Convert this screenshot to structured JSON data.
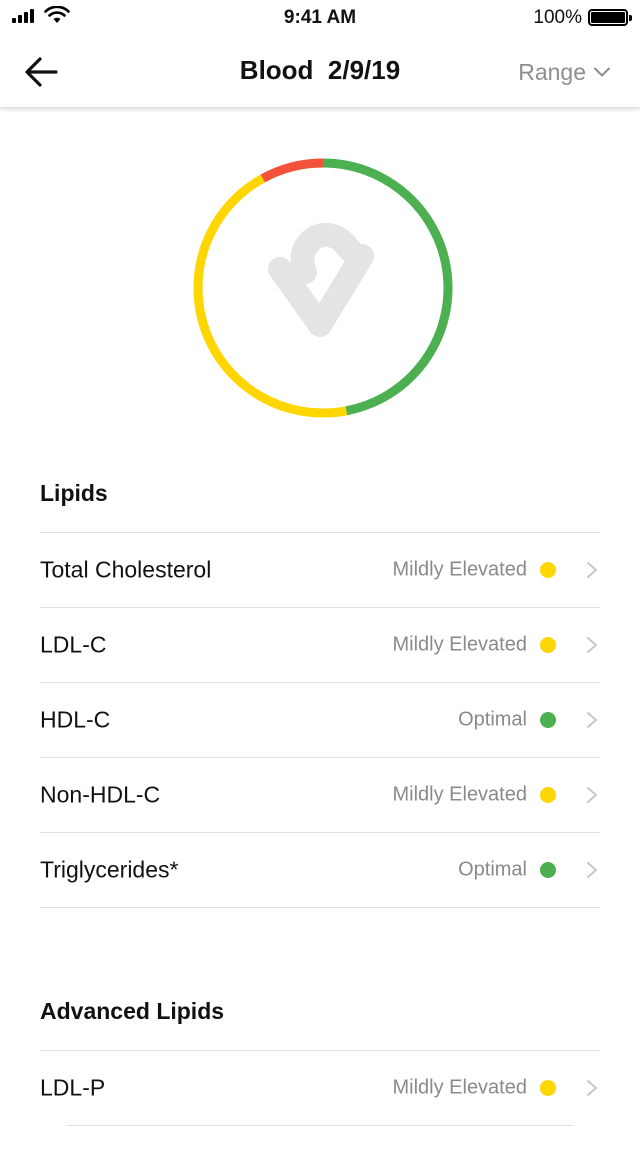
{
  "status_bar": {
    "time": "9:41 AM",
    "battery": "100%"
  },
  "header": {
    "title": "Blood  2/9/19",
    "range_label": "Range"
  },
  "colors": {
    "optimal": "#4caf50",
    "mildly_elevated": "#ffd600",
    "elevated": "#f4513b",
    "divider": "#e0e0e0"
  },
  "score_ring": {
    "icon": "heart-icon",
    "segments": [
      {
        "status": "elevated",
        "fraction": 0.08
      },
      {
        "status": "optimal",
        "fraction": 0.47
      },
      {
        "status": "mildly_elevated",
        "fraction": 0.45
      }
    ]
  },
  "sections": [
    {
      "title": "Lipids",
      "items": [
        {
          "name": "Total Cholesterol",
          "status": "Mildly Elevated",
          "level": "mildly_elevated"
        },
        {
          "name": "LDL-C",
          "status": "Mildly Elevated",
          "level": "mildly_elevated"
        },
        {
          "name": "HDL-C",
          "status": "Optimal",
          "level": "optimal"
        },
        {
          "name": "Non-HDL-C",
          "status": "Mildly Elevated",
          "level": "mildly_elevated"
        },
        {
          "name": "Triglycerides*",
          "status": "Optimal",
          "level": "optimal"
        }
      ]
    },
    {
      "title": "Advanced Lipids",
      "items": [
        {
          "name": "LDL-P",
          "status": "Mildly Elevated",
          "level": "mildly_elevated"
        }
      ]
    }
  ]
}
